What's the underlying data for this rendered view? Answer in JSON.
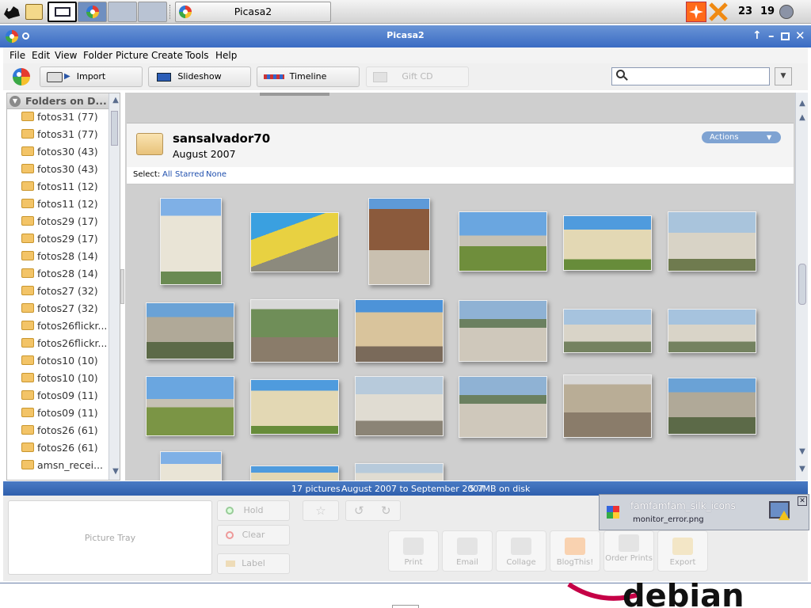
{
  "panel": {
    "task_title": "Picasa2",
    "clock_left": "23",
    "clock_right": "19",
    "icons": [
      "debian-launcher-icon",
      "image-viewer-icon",
      "desktop-icon",
      "picasa-icon",
      "flash-icon",
      "network-error-icon",
      "volume-icon"
    ]
  },
  "window": {
    "title": "Picasa2"
  },
  "menu": [
    "File",
    "Edit",
    "View",
    "Folder",
    "Picture",
    "Create",
    "Tools",
    "Help"
  ],
  "toolbar": {
    "import": "Import",
    "slideshow": "Slideshow",
    "timeline": "Timeline",
    "giftcd": "Gift CD",
    "search_value": ""
  },
  "sidebar": {
    "header": "Folders on D...",
    "folders": [
      "fotos31 (77)",
      "fotos31 (77)",
      "fotos30 (43)",
      "fotos30 (43)",
      "fotos11 (12)",
      "fotos11 (12)",
      "fotos29 (17)",
      "fotos29 (17)",
      "fotos28 (14)",
      "fotos28 (14)",
      "fotos27 (32)",
      "fotos27 (32)",
      "fotos26flickr...",
      "fotos26flickr...",
      "fotos10 (10)",
      "fotos10 (10)",
      "fotos09 (11)",
      "fotos09 (11)",
      "fotos26 (61)",
      "fotos26 (61)",
      "amsn_recei..."
    ]
  },
  "album": {
    "name": "sansalvador70",
    "date": "August 2007",
    "actions": "Actions",
    "select_label": "Select:",
    "select_all": "All",
    "select_starred": "Starred",
    "select_none": "None"
  },
  "status": {
    "count": "17 pictures",
    "range": "August 2007 to September 2007",
    "size": "5.7MB on disk"
  },
  "tray": {
    "label": "Picture Tray",
    "hold": "Hold",
    "clear": "Clear",
    "label_btn": "Label"
  },
  "actions": [
    "Print",
    "Email",
    "Collage",
    "BlogThis!",
    "Order Prints",
    "Export"
  ],
  "notification": {
    "title": "famfamfam_silk_icons",
    "file": "monitor_error.png"
  },
  "colors": {
    "titlebar": "#3a6bc3",
    "status": "#2f5fad",
    "link": "#1f4fae",
    "actions_btn": "#7fa3d2"
  }
}
